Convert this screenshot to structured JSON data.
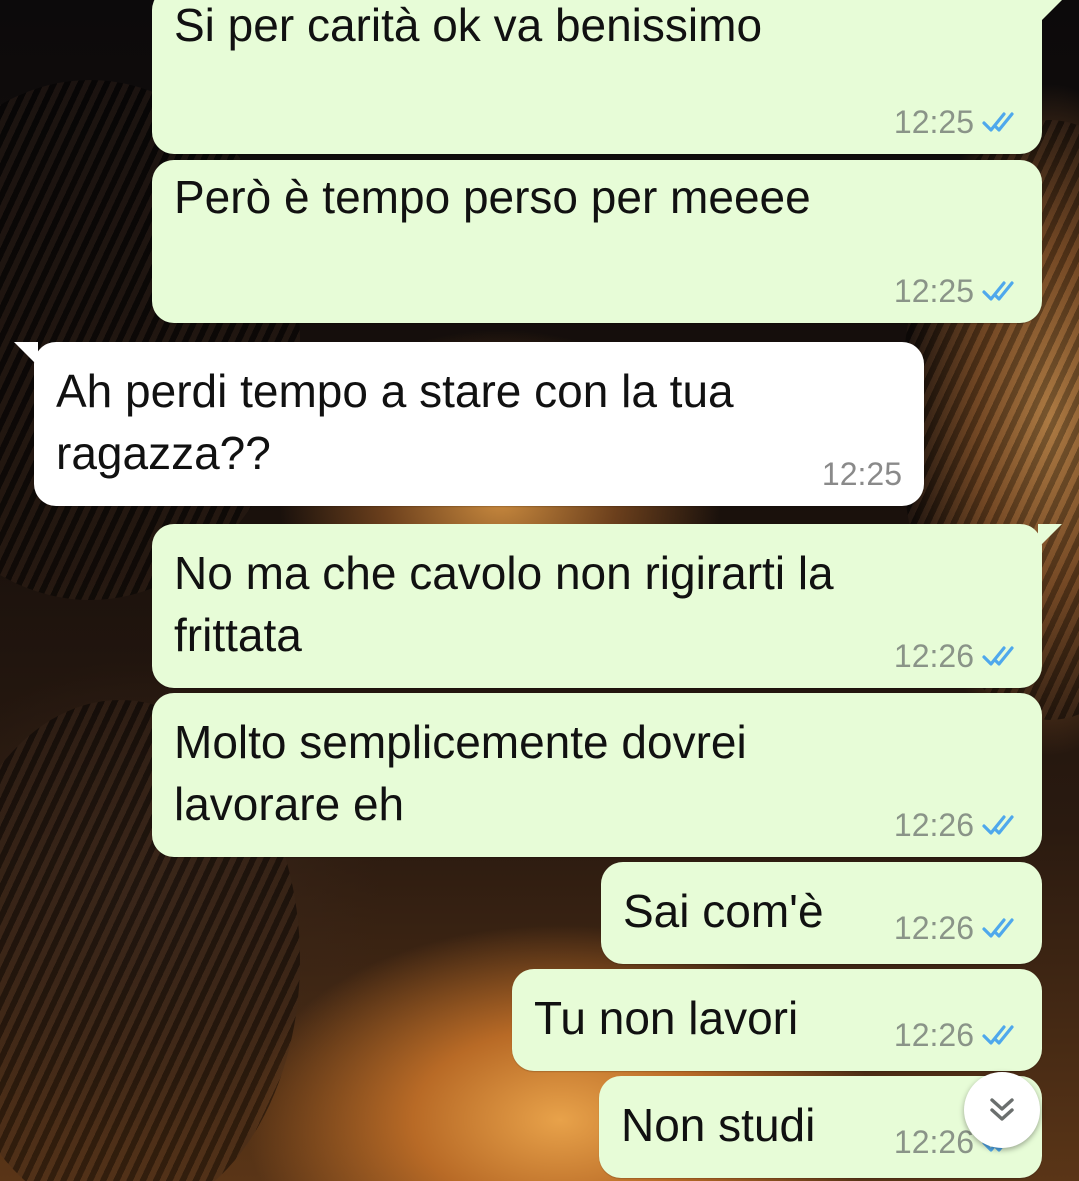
{
  "colors": {
    "outgoing_bubble": "#e7fcd7",
    "incoming_bubble": "#ffffff",
    "read_tick": "#4fa8ec"
  },
  "messages": [
    {
      "direction": "out",
      "text": "Si per carità ok va benissimo",
      "time": "12:25",
      "status_icon": "double-check-read-icon"
    },
    {
      "direction": "out",
      "text": "Però è tempo perso per meeee",
      "time": "12:25",
      "status_icon": "double-check-read-icon"
    },
    {
      "direction": "in",
      "text": "Ah perdi tempo a stare con la tua\nragazza??",
      "time": "12:25"
    },
    {
      "direction": "out",
      "text": "No ma che cavolo non rigirarti la\nfrittata",
      "time": "12:26",
      "status_icon": "double-check-read-icon"
    },
    {
      "direction": "out",
      "text": "Molto semplicemente dovrei\nlavorare eh",
      "time": "12:26",
      "status_icon": "double-check-read-icon"
    },
    {
      "direction": "out",
      "text": "Sai com'è",
      "time": "12:26",
      "status_icon": "double-check-read-icon"
    },
    {
      "direction": "out",
      "text": "Tu non lavori",
      "time": "12:26",
      "status_icon": "double-check-read-icon"
    },
    {
      "direction": "out",
      "text": "Non studi",
      "time": "12:26",
      "status_icon": "double-check-read-icon"
    }
  ],
  "scroll_button": {
    "icon": "double-chevron-down-icon"
  }
}
